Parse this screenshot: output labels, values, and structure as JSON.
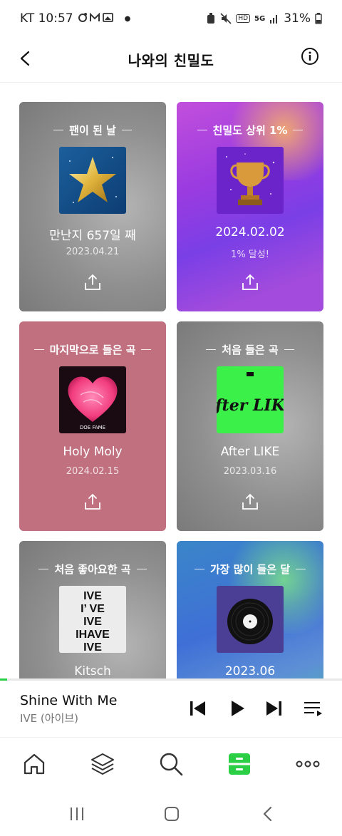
{
  "status_bar": {
    "carrier_time": "KT 10:57",
    "battery": "31%",
    "hd_label": "HD",
    "network_label": "5G"
  },
  "header": {
    "title": "나와의 친밀도"
  },
  "cards": [
    {
      "title": "팬이 된 날",
      "main": "만난지 657일 째",
      "sub": "2023.04.21",
      "art_icon": "star-artwork"
    },
    {
      "title": "친밀도 상위 1%",
      "main": "2024.02.02",
      "sub": "1% 달성!",
      "art_icon": "trophy-artwork"
    },
    {
      "title": "마지막으로 들은 곡",
      "main": "Holy Moly",
      "sub": "2024.02.15",
      "art_icon": "heart-album-art"
    },
    {
      "title": "처음 들은 곡",
      "main": "After LIKE",
      "sub": "2023.03.16",
      "art_icon": "after-like-album-art"
    },
    {
      "title": "처음 좋아요한 곡",
      "main": "Kitsch",
      "sub": "",
      "art_icon": "ive-album-art"
    },
    {
      "title": "가장 많이 들은 달",
      "main": "2023.06",
      "sub": "",
      "art_icon": "vinyl-record-art"
    }
  ],
  "album_texts": {
    "heart_album": "DOE FAME",
    "after_like": "After LIKE",
    "ive_lines": [
      "IVE",
      "I’  VE",
      "IVE",
      "IHAVE",
      "IVE"
    ]
  },
  "player": {
    "song_title": "Shine With Me",
    "artist": "IVE (아이브)",
    "progress_fraction": 0.02
  },
  "bottom_nav": {
    "items": [
      "home-icon",
      "library-icon",
      "search-icon",
      "storage-icon",
      "more-icon"
    ],
    "active_index": 3
  },
  "colors": {
    "accent": "#2bcf45",
    "card_gray": "#8f8f8f",
    "card_pink": "#c0707f",
    "card_purple": "#8a3fe0",
    "card_blue": "#3f6fd6"
  }
}
